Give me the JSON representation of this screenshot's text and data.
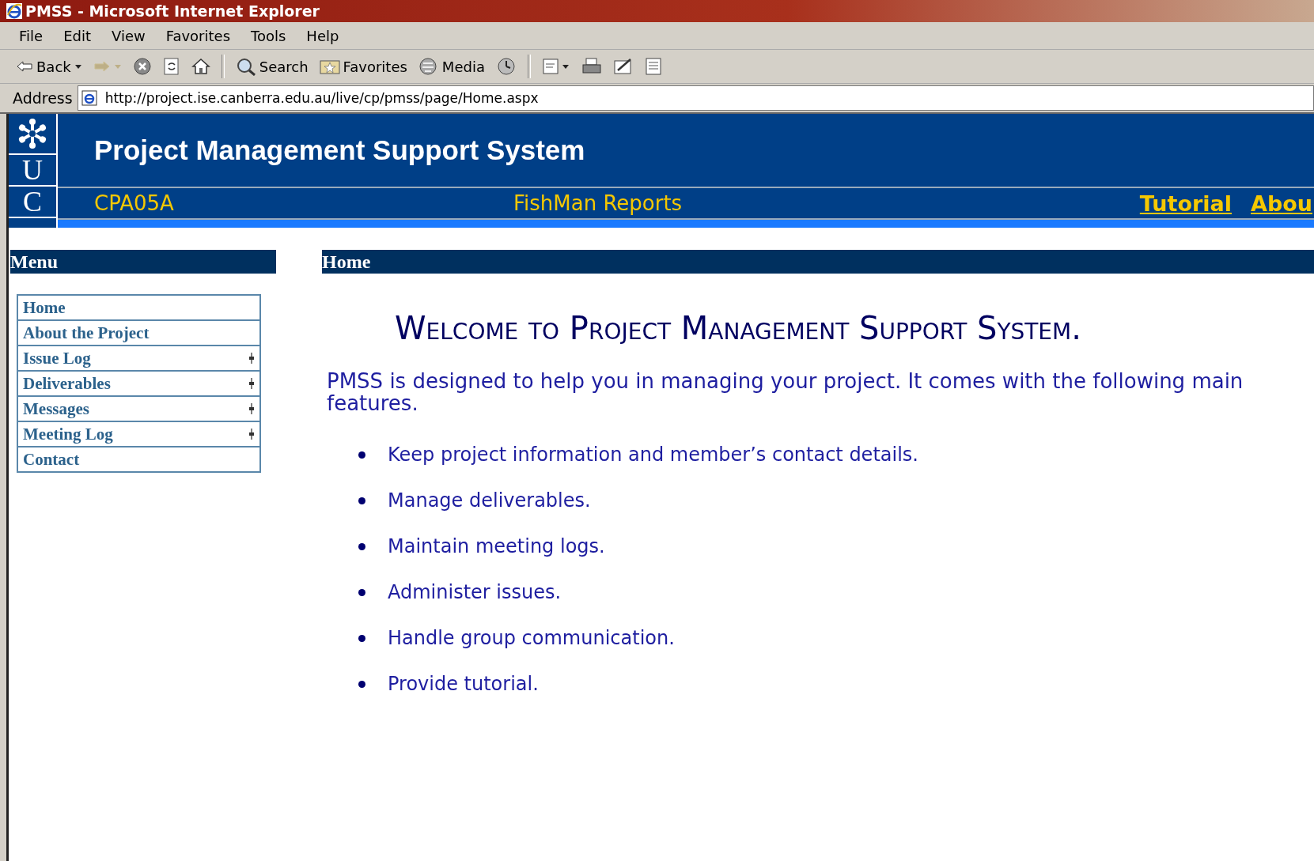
{
  "window": {
    "title": "PMSS - Microsoft Internet Explorer"
  },
  "menu_bar": [
    "File",
    "Edit",
    "View",
    "Favorites",
    "Tools",
    "Help"
  ],
  "toolbar": [
    {
      "kind": "back",
      "label": "Back",
      "disabled": false
    },
    {
      "kind": "forward",
      "disabled": true
    },
    {
      "kind": "stop",
      "disabled": false
    },
    {
      "kind": "refresh",
      "disabled": false
    },
    {
      "kind": "home",
      "disabled": false
    },
    {
      "kind": "separator"
    },
    {
      "kind": "search",
      "label": "Search",
      "disabled": false
    },
    {
      "kind": "favorites",
      "label": "Favorites",
      "disabled": false
    },
    {
      "kind": "media",
      "label": "Media",
      "disabled": false
    },
    {
      "kind": "history",
      "disabled": false
    },
    {
      "kind": "separator"
    },
    {
      "kind": "mail",
      "disabled": false
    },
    {
      "kind": "print",
      "disabled": false
    },
    {
      "kind": "edit",
      "disabled": false
    },
    {
      "kind": "discuss",
      "disabled": false
    }
  ],
  "address_bar": {
    "label": "Address",
    "value": "http://project.ise.canberra.edu.au/live/cp/pmss/page/Home.aspx"
  },
  "site_header": {
    "logo_letters": [
      "U",
      "C"
    ],
    "title": "Project Management Support System",
    "project_code": "CPA05A",
    "project_name": "FishMan Reports",
    "links": [
      "Tutorial",
      "Abou"
    ]
  },
  "sidebar": {
    "heading": "Menu",
    "items": [
      {
        "label": "Home",
        "expandable": false
      },
      {
        "label": "About the Project",
        "expandable": false
      },
      {
        "label": "Issue Log",
        "expandable": true
      },
      {
        "label": "Deliverables",
        "expandable": true
      },
      {
        "label": "Messages",
        "expandable": true
      },
      {
        "label": "Meeting Log",
        "expandable": true
      },
      {
        "label": "Contact",
        "expandable": false
      }
    ]
  },
  "content": {
    "heading": "Home",
    "title": "Welcome to Project Management Support System.",
    "intro": "PMSS is designed to help you in managing your project. It comes with the following main features.",
    "features": [
      "Keep project information and member’s contact details.",
      "Manage deliverables.",
      "Maintain meeting logs.",
      "Administer issues.",
      "Handle group communication.",
      "Provide tutorial."
    ]
  }
}
